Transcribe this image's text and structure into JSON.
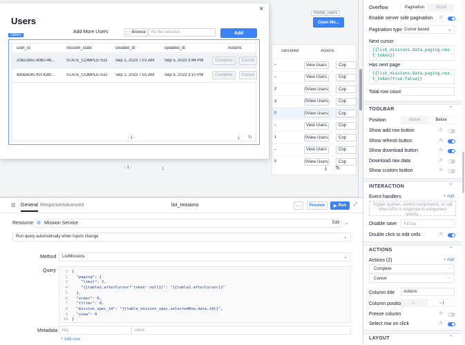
{
  "bg_table": {
    "headers": [
      "cancelled",
      "Actions"
    ],
    "rows": [
      {
        "cancelled": "–",
        "action": "View Users",
        "extra": "Cop"
      },
      {
        "cancelled": "–",
        "action": "View Users",
        "extra": "Cop"
      },
      {
        "cancelled": "2",
        "action": "0View Users",
        "extra": "Cop"
      },
      {
        "cancelled": "3",
        "action": "0View Users",
        "extra": "Cop"
      },
      {
        "cancelled": "0",
        "action": "0View Users",
        "extra": "Cop"
      },
      {
        "cancelled": "–",
        "action": "View Users",
        "extra": "Cop"
      },
      {
        "cancelled": "1",
        "action": "0View Users",
        "extra": "Cop"
      },
      {
        "cancelled": "–",
        "action": "View Users",
        "extra": "Cop"
      },
      {
        "cancelled": "0",
        "action": "0View Users",
        "extra": "Cop"
      }
    ],
    "pager_page": "1",
    "modal_tag": "modal_users",
    "open_button": "Open Mo..."
  },
  "modal": {
    "title": "Users",
    "close": "×",
    "add_more_label": "Add More Users",
    "browse": "Browse",
    "file_placeholder": "No file selected",
    "add_button": "Add",
    "table_tag": "table2",
    "columns": [
      "user_id",
      "mission_state",
      "created_dt",
      "updated_dt",
      "Actions"
    ],
    "rows": [
      {
        "user_id": "20621b5c-8060-49...",
        "mission_state": "STATE_COMPLETED",
        "created_dt": "Sep 1, 2023 7:01 AM",
        "updated_dt": "Sep 5, 2023 3:44 PM",
        "complete": "Complete",
        "cancel": "Cancel"
      },
      {
        "user_id": "8d0e8c45-ffcf-42bf...",
        "mission_state": "STATE_COMPLETED",
        "created_dt": "Sep 1, 2023 7:01 AM",
        "updated_dt": "Sep 5, 2023 3:10 PM",
        "complete": "Complete",
        "cancel": "Cancel"
      }
    ],
    "page": "1"
  },
  "query_editor": {
    "tabs": [
      "General",
      "Response",
      "Advanced"
    ],
    "query_name": "list_missions",
    "preview": "Preview",
    "run": "Run",
    "resource_label": "Resource",
    "resource_value": "Mission Service",
    "edit": "Edit",
    "run_mode": "Run query automatically when inputs change",
    "method_label": "Method",
    "method_value": "ListMissions",
    "query_label": "Query",
    "code_lines": [
      "{",
      "  \"paging\": {",
      "    \"limit\": 2,",
      "    \"{{table2.afterCursor?'token':null}}\": \"{{table2.afterCursor}}\"",
      "  },",
      "  \"order\": 0,",
      "  \"filter\": 0,",
      "  \"mission_spec_id\": \"{{table_mission_spec.selectedRow.data.id}}\",",
      "  \"view\": 0",
      "}"
    ],
    "line_numbers": [
      "1",
      "2",
      "3",
      "4",
      "5",
      "6",
      "7",
      "8",
      "9",
      "10"
    ],
    "metadata_label": "Metadata",
    "key_placeholder": "key",
    "value_placeholder": "value",
    "add_new": "+ Add new"
  },
  "inspector": {
    "overflow_label": "Overflow",
    "overflow_options": [
      "Pagination",
      "Scroll"
    ],
    "server_side_label": "Enable server side pagination",
    "pagination_type_label": "Pagination type",
    "pagination_type_value": "Cursor based",
    "next_cursor_label": "Next cursor",
    "next_cursor_value": "{{list_missions.data.paging.next_token}}",
    "has_next_label": "Has next page",
    "has_next_value": "{{list_missions.data.paging.next_token?true:false}}",
    "total_row_label": "Total row count",
    "toolbar_title": "TOOLBAR",
    "position_label": "Position",
    "position_options": [
      "Above",
      "Below"
    ],
    "toolbar_items": [
      {
        "label": "Show add row button",
        "on": false
      },
      {
        "label": "Show refresh button",
        "on": true
      },
      {
        "label": "Show download button",
        "on": true
      },
      {
        "label": "Download raw data",
        "on": false
      },
      {
        "label": "Show custom button",
        "on": false
      }
    ],
    "interaction_title": "INTERACTION",
    "event_handlers_label": "Event handlers",
    "add": "+ Add",
    "event_help": "Trigger queries, control components, or call other APIs in response to component events.",
    "disable_save_label": "Disable save",
    "disable_save_value": "false",
    "double_click_label": "Double click to edit cells",
    "actions_title": "ACTIONS",
    "actions_label": "Actions (2)",
    "action_items": [
      "Complete",
      "Cancel"
    ],
    "column_title_label": "Column title",
    "column_title_value": "Actions",
    "column_position_label": "Column position",
    "freeze_label": "Freeze column",
    "select_row_label": "Select row on click",
    "layout_title": "LAYOUT",
    "fx": "fx"
  },
  "colors": {
    "accent": "#3b82f6",
    "modal_border": "#60a5fa"
  }
}
